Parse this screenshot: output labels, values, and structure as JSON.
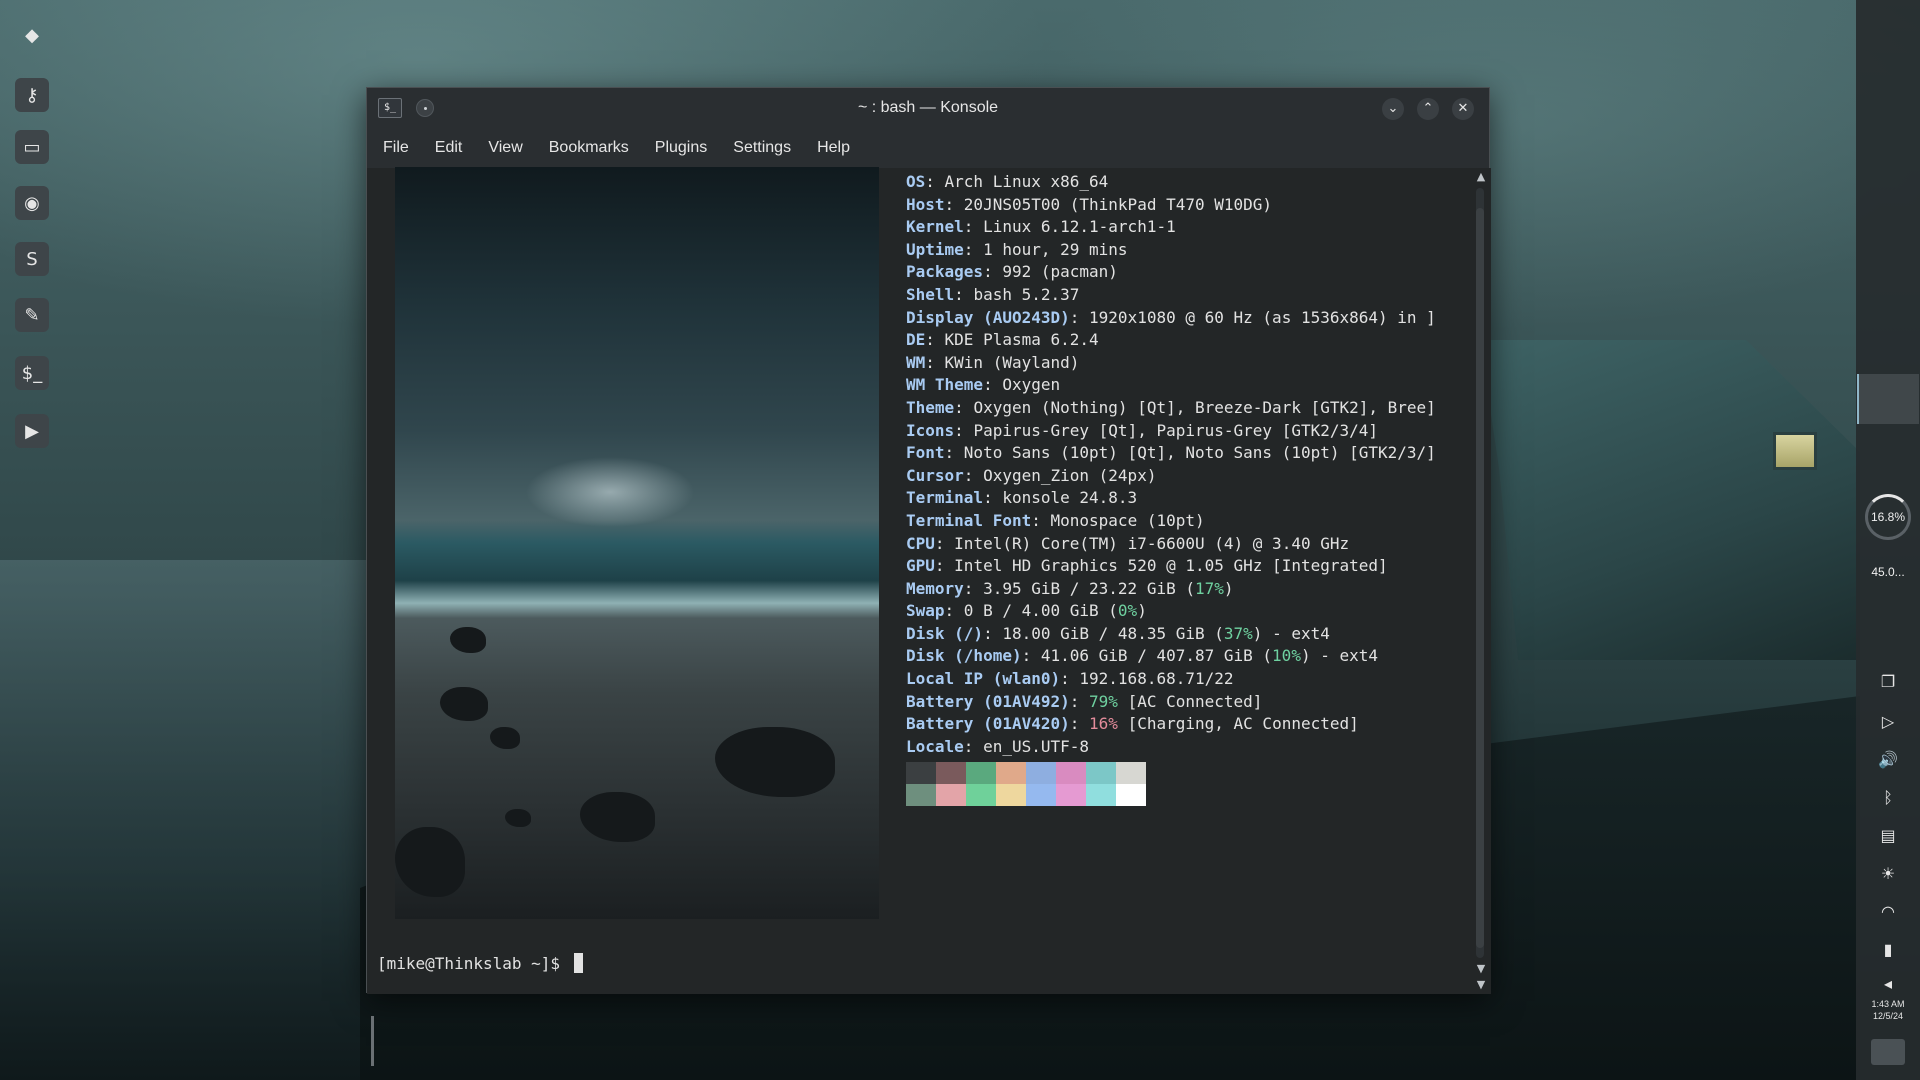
{
  "window": {
    "title": "~ : bash — Konsole",
    "app_icon_glyph": "$_",
    "buttons": {
      "minimize": "⌄",
      "maximize": "⌃",
      "close": "✕"
    }
  },
  "menu": [
    "File",
    "Edit",
    "View",
    "Bookmarks",
    "Plugins",
    "Settings",
    "Help"
  ],
  "fastfetch": [
    {
      "key": "OS",
      "value": "Arch Linux x86_64"
    },
    {
      "key": "Host",
      "value": "20JNS05T00 (ThinkPad T470 W10DG)"
    },
    {
      "key": "Kernel",
      "value": "Linux 6.12.1-arch1-1"
    },
    {
      "key": "Uptime",
      "value": "1 hour, 29 mins"
    },
    {
      "key": "Packages",
      "value": "992 (pacman)"
    },
    {
      "key": "Shell",
      "value": "bash 5.2.37"
    },
    {
      "key": "Display (AUO243D)",
      "value": "1920x1080 @ 60 Hz (as 1536x864) in ]"
    },
    {
      "key": "DE",
      "value": "KDE Plasma 6.2.4"
    },
    {
      "key": "WM",
      "value": "KWin (Wayland)"
    },
    {
      "key": "WM Theme",
      "value": "Oxygen"
    },
    {
      "key": "Theme",
      "value": "Oxygen (Nothing) [Qt], Breeze-Dark [GTK2], Bree]"
    },
    {
      "key": "Icons",
      "value": "Papirus-Grey [Qt], Papirus-Grey [GTK2/3/4]"
    },
    {
      "key": "Font",
      "value": "Noto Sans (10pt) [Qt], Noto Sans (10pt) [GTK2/3/]"
    },
    {
      "key": "Cursor",
      "value": "Oxygen_Zion (24px)"
    },
    {
      "key": "Terminal",
      "value": "konsole 24.8.3"
    },
    {
      "key": "Terminal Font",
      "value": "Monospace (10pt)"
    },
    {
      "key": "CPU",
      "value": "Intel(R) Core(TM) i7-6600U (4) @ 3.40 GHz"
    },
    {
      "key": "GPU",
      "value": "Intel HD Graphics 520 @ 1.05 GHz [Integrated]"
    },
    {
      "key": "Memory",
      "value": "3.95 GiB / 23.22 GiB (",
      "pct": "17%",
      "pct_color": "green",
      "suffix": ")"
    },
    {
      "key": "Swap",
      "value": "0 B / 4.00 GiB (",
      "pct": "0%",
      "pct_color": "green",
      "suffix": ")"
    },
    {
      "key": "Disk (/)",
      "value": "18.00 GiB / 48.35 GiB (",
      "pct": "37%",
      "pct_color": "green",
      "suffix": ") - ext4"
    },
    {
      "key": "Disk (/home)",
      "value": "41.06 GiB / 407.87 GiB (",
      "pct": "10%",
      "pct_color": "green",
      "suffix": ") - ext4"
    },
    {
      "key": "Local IP (wlan0)",
      "value": "192.168.68.71/22"
    },
    {
      "key": "Battery (01AV492)",
      "value": "",
      "pct": "79%",
      "pct_color": "green",
      "suffix": " [AC Connected]"
    },
    {
      "key": "Battery (01AV420)",
      "value": "",
      "pct": "16%",
      "pct_color": "red",
      "suffix": " [Charging, AC Connected]"
    },
    {
      "key": "Locale",
      "value": "en_US.UTF-8"
    }
  ],
  "palette": {
    "top": [
      "#3b3f41",
      "#7a5a5c",
      "#5aa97e",
      "#e0a98a",
      "#8eaee0",
      "#d98bc0",
      "#7cc7c7",
      "#d7d7d2"
    ],
    "bottom": [
      "#6e8f7e",
      "#e3a4a8",
      "#6fd19a",
      "#eed79e",
      "#95b9ef",
      "#e59ad2",
      "#90dede",
      "#ffffff"
    ]
  },
  "prompt": "[mike@Thinkslab ~]$ ",
  "panel": {
    "cpu": "16.8%",
    "mem": "45.0...",
    "clock_time": "1:43 AM",
    "clock_date": "12/5/24",
    "launcher_icons": [
      "app-menu-icon",
      "keepassxc-icon",
      "files-icon",
      "globe-icon",
      "sublime-icon",
      "editor-icon",
      "terminal-icon",
      "media-player-icon"
    ],
    "tray_icons": [
      "clipboard-icon",
      "media-icon",
      "volume-icon",
      "bluetooth-icon",
      "drive-icon",
      "brightness-icon",
      "wifi-icon",
      "battery-icon",
      "expand-icon"
    ]
  },
  "colors": {
    "key": "#a9cbf2",
    "pct_green": "#6fd1a0",
    "pct_red": "#e38c9b",
    "terminal_bg": "#232627"
  }
}
